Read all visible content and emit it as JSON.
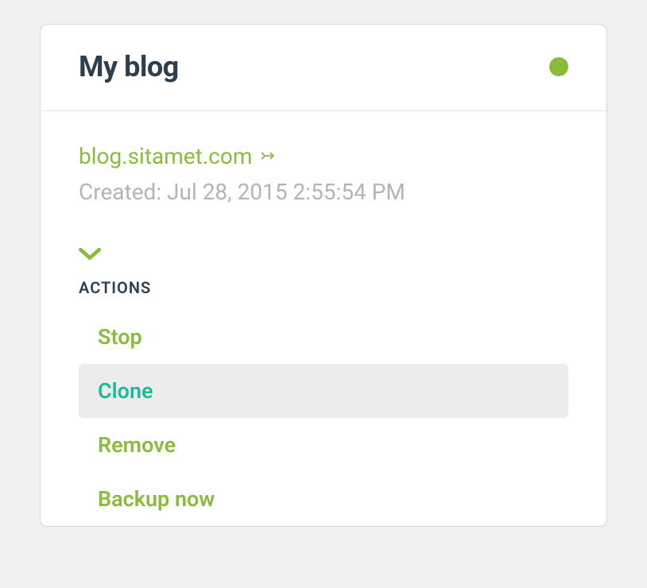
{
  "card": {
    "title": "My blog",
    "status_color": "#8bbb3c",
    "domain": "blog.sitamet.com",
    "created_label": "Created: Jul 28, 2015 2:55:54 PM",
    "actions_label": "ACTIONS",
    "actions": [
      {
        "label": "Stop"
      },
      {
        "label": "Clone"
      },
      {
        "label": "Remove"
      },
      {
        "label": "Backup now"
      }
    ]
  }
}
